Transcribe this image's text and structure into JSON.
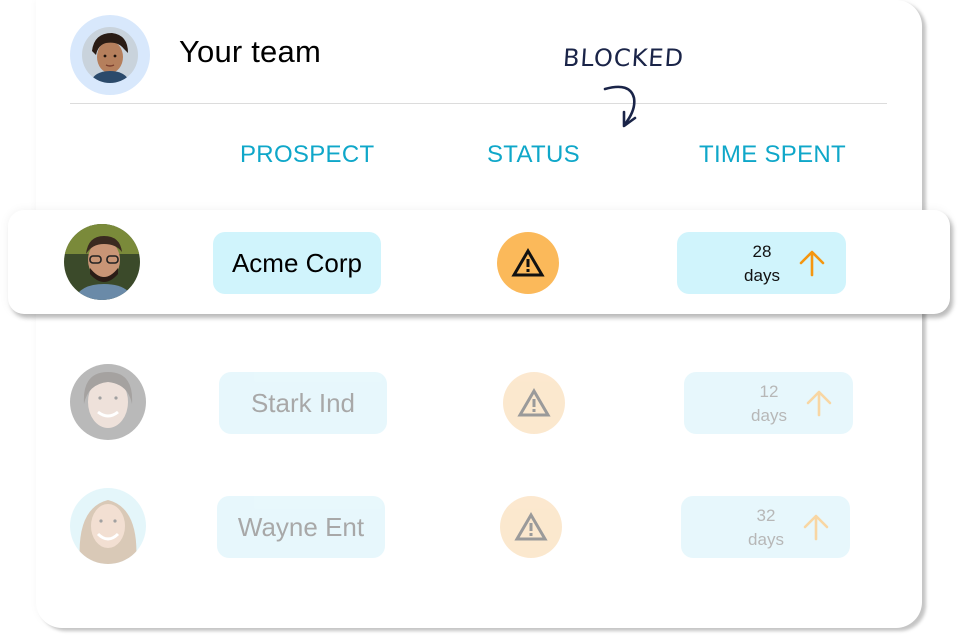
{
  "header": {
    "title": "Your team",
    "annotation": "BLOCKED"
  },
  "columns": {
    "prospect": "PROSPECT",
    "status": "STATUS",
    "time_spent": "TIME SPENT"
  },
  "rows": [
    {
      "prospect": "Acme Corp",
      "status_icon": "warning-icon",
      "status": "blocked",
      "time_value": "28",
      "time_unit": "days",
      "trend_icon": "arrow-up-icon",
      "highlighted": true
    },
    {
      "prospect": "Stark Ind",
      "status_icon": "warning-icon",
      "status": "blocked",
      "time_value": "12",
      "time_unit": "days",
      "trend_icon": "arrow-up-icon",
      "highlighted": false
    },
    {
      "prospect": "Wayne Ent",
      "status_icon": "warning-icon",
      "status": "blocked",
      "time_value": "32",
      "time_unit": "days",
      "trend_icon": "arrow-up-icon",
      "highlighted": false
    }
  ],
  "colors": {
    "accent": "#0fa7c9",
    "pill_bg": "#d0f4fc",
    "warning": "#fbb95a",
    "trend_arrow": "#f5960f",
    "annotation_ink": "#1a2448"
  }
}
